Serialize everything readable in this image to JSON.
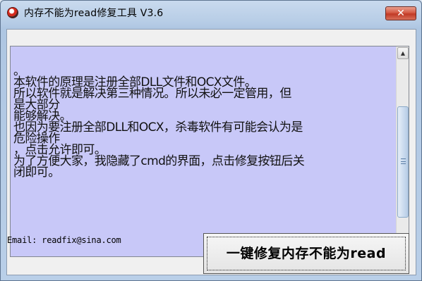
{
  "window": {
    "title": "内存不能为read修复工具 V3.6",
    "close_label": "✕",
    "icon": "app-icon"
  },
  "info_text": {
    "lines": [
      "。",
      "本软件的原理是注册全部DLL文件和OCX文件。",
      "所以软件就是解决第三种情况。所以未必一定管用，但",
      "是大部分",
      "能够解决。",
      "也因为要注册全部DLL和OCX，杀毒软件有可能会认为是",
      "危险操作",
      "，点击允许即可。",
      "为了方便大家，我隐藏了cmd的界面，点击修复按钮后关",
      "闭即可。"
    ]
  },
  "scrollbar": {
    "up_arrow": "▲",
    "down_arrow": "▼"
  },
  "footer": {
    "email": "Email: readfix@sina.com",
    "repair_button": "一键修复内存不能为read"
  },
  "colors": {
    "textbox_bg": "#c8c8f8",
    "close_button": "#c13a25"
  }
}
